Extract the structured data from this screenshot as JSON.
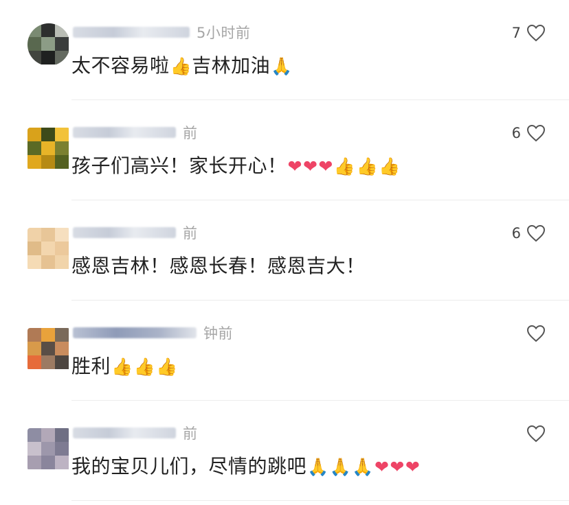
{
  "comments": [
    {
      "avatar": [
        "#7a8a72",
        "#2d2f2e",
        "#b9bdb5",
        "#59684f",
        "#8c9c86",
        "#3a3d3c"
      ],
      "time": "5小时前",
      "text": "太不容易啦",
      "text_after_1": "吉林加油",
      "emojis_1": [
        "thumbs-up"
      ],
      "emojis_2": [
        "folded-hands"
      ],
      "likes": "7"
    },
    {
      "avatar": [
        "#d9a21b",
        "#3d4a1a",
        "#f2c23a",
        "#5b6a25",
        "#e8b428",
        "#7b8030"
      ],
      "time": "前",
      "text": "孩子们高兴！家长开心！",
      "emojis": [
        "heart",
        "heart",
        "heart",
        "thumbs-up",
        "thumbs-up",
        "thumbs-up"
      ],
      "likes": "6"
    },
    {
      "avatar": [
        "#f0d2a8",
        "#e8c698",
        "#f6dfbf",
        "#e0bb88",
        "#f3d6ae",
        "#ecc99c"
      ],
      "time": "前",
      "text": "感恩吉林！感恩长春！感恩吉大！",
      "likes": "6"
    },
    {
      "avatar": [
        "#b07a55",
        "#e9a23b",
        "#7a6a5a",
        "#d89a4a",
        "#5a4e46",
        "#c98c5e"
      ],
      "time": "钟前",
      "text": "胜利",
      "emojis": [
        "thumbs-up",
        "thumbs-up",
        "thumbs-up"
      ],
      "likes": ""
    },
    {
      "avatar": [
        "#8e8da3",
        "#b2a8b8",
        "#6f6f84",
        "#c8c0cc",
        "#9d97ab",
        "#7e7b92"
      ],
      "time": "前",
      "text": "我的宝贝儿们，尽情的跳吧",
      "emojis": [
        "folded-hands",
        "folded-hands",
        "folded-hands",
        "heart",
        "heart",
        "heart"
      ],
      "likes": ""
    }
  ]
}
